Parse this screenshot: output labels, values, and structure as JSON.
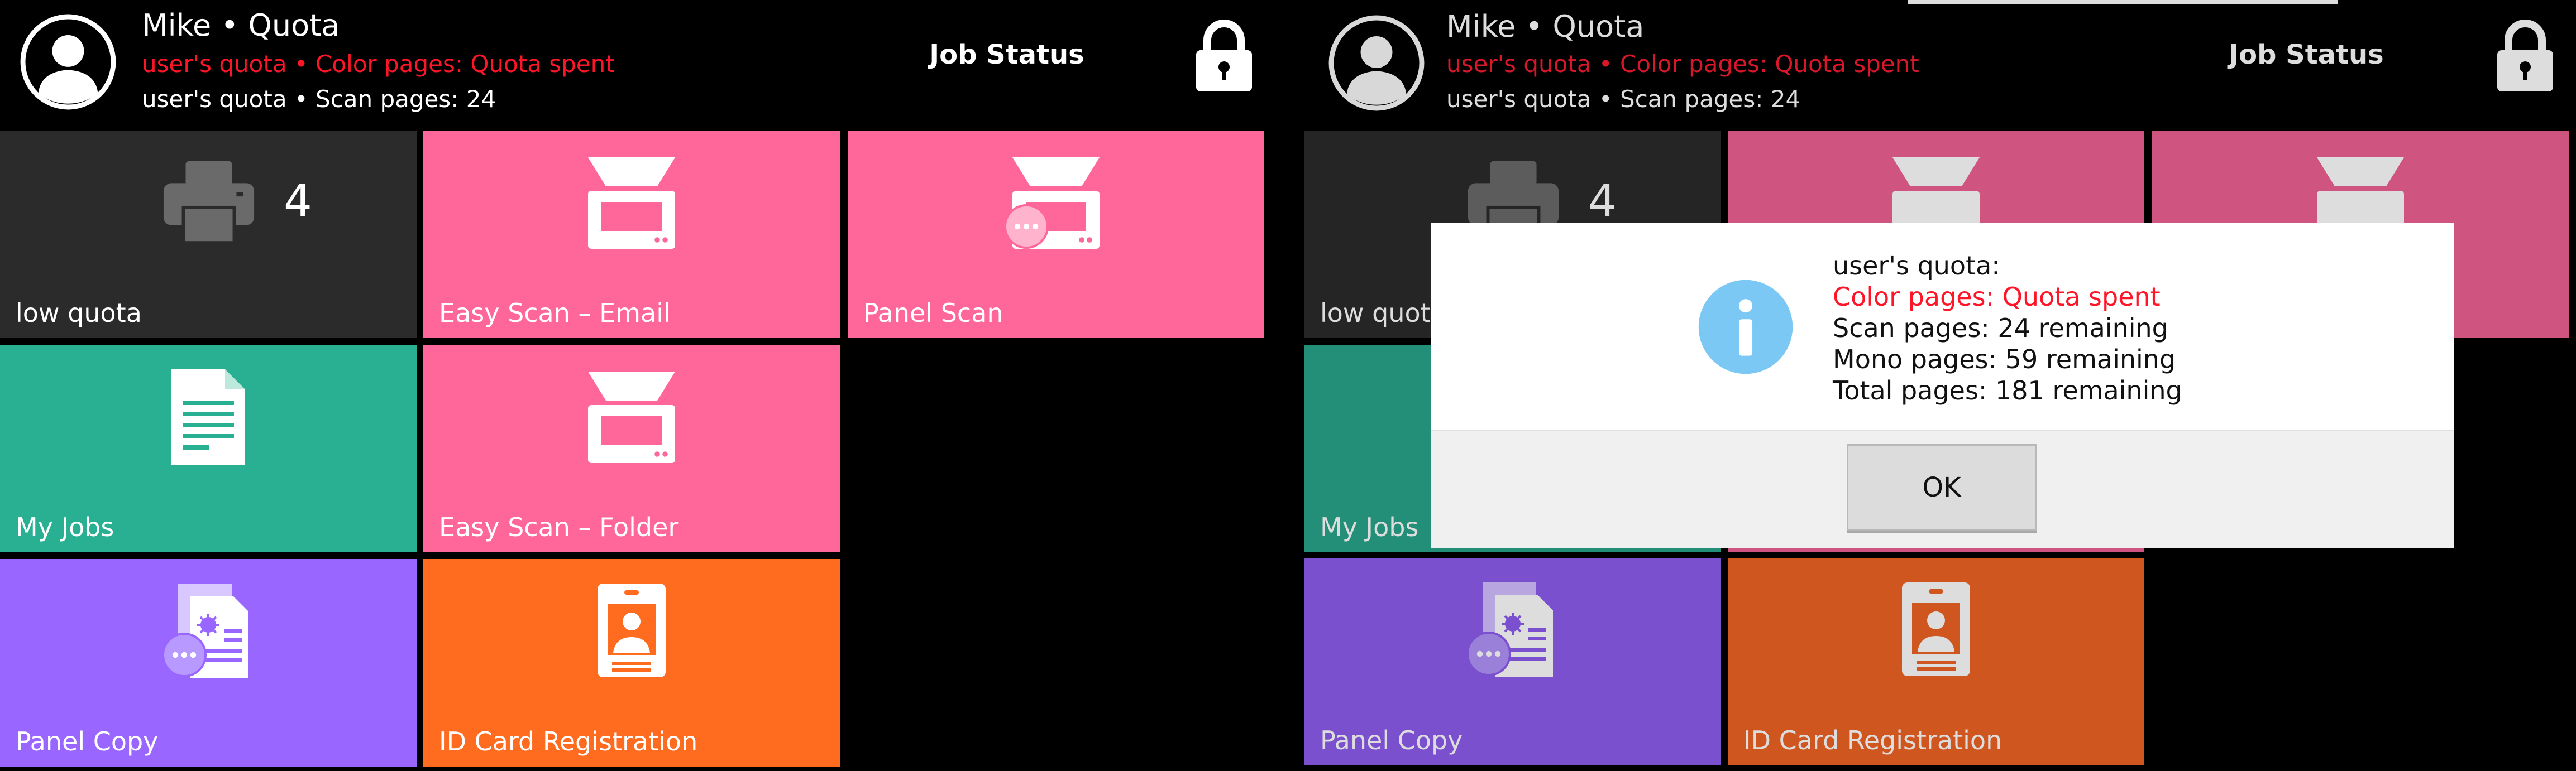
{
  "header": {
    "user_name": "Mike • Quota",
    "quota_color": "user's quota • Color pages: Quota spent",
    "quota_scan": "user's quota • Scan pages: 24",
    "job_status": "Job Status"
  },
  "tiles": {
    "printer": {
      "label": "low quota",
      "count": "4"
    },
    "easy_scan_email": {
      "label": "Easy Scan – Email"
    },
    "panel_scan": {
      "label": "Panel Scan"
    },
    "my_jobs": {
      "label": "My Jobs"
    },
    "easy_scan_folder": {
      "label": "Easy Scan – Folder"
    },
    "panel_copy": {
      "label": "Panel Copy"
    },
    "id_card": {
      "label": "ID Card Registration"
    }
  },
  "dialog": {
    "title": "user's quota:",
    "color_line": "Color pages: Quota spent",
    "scan_line": "Scan pages: 24 remaining",
    "mono_line": "Mono pages: 59 remaining",
    "total_line": "Total pages: 181 remaining",
    "ok_label": "OK"
  },
  "colors": {
    "pink": "#ff6699",
    "teal": "#29b093",
    "purple": "#9966ff",
    "orange": "#ff6b1f",
    "dark_tile": "#2b2b2b",
    "quota_red": "#ff1528",
    "info_blue": "#7cc8f5"
  }
}
